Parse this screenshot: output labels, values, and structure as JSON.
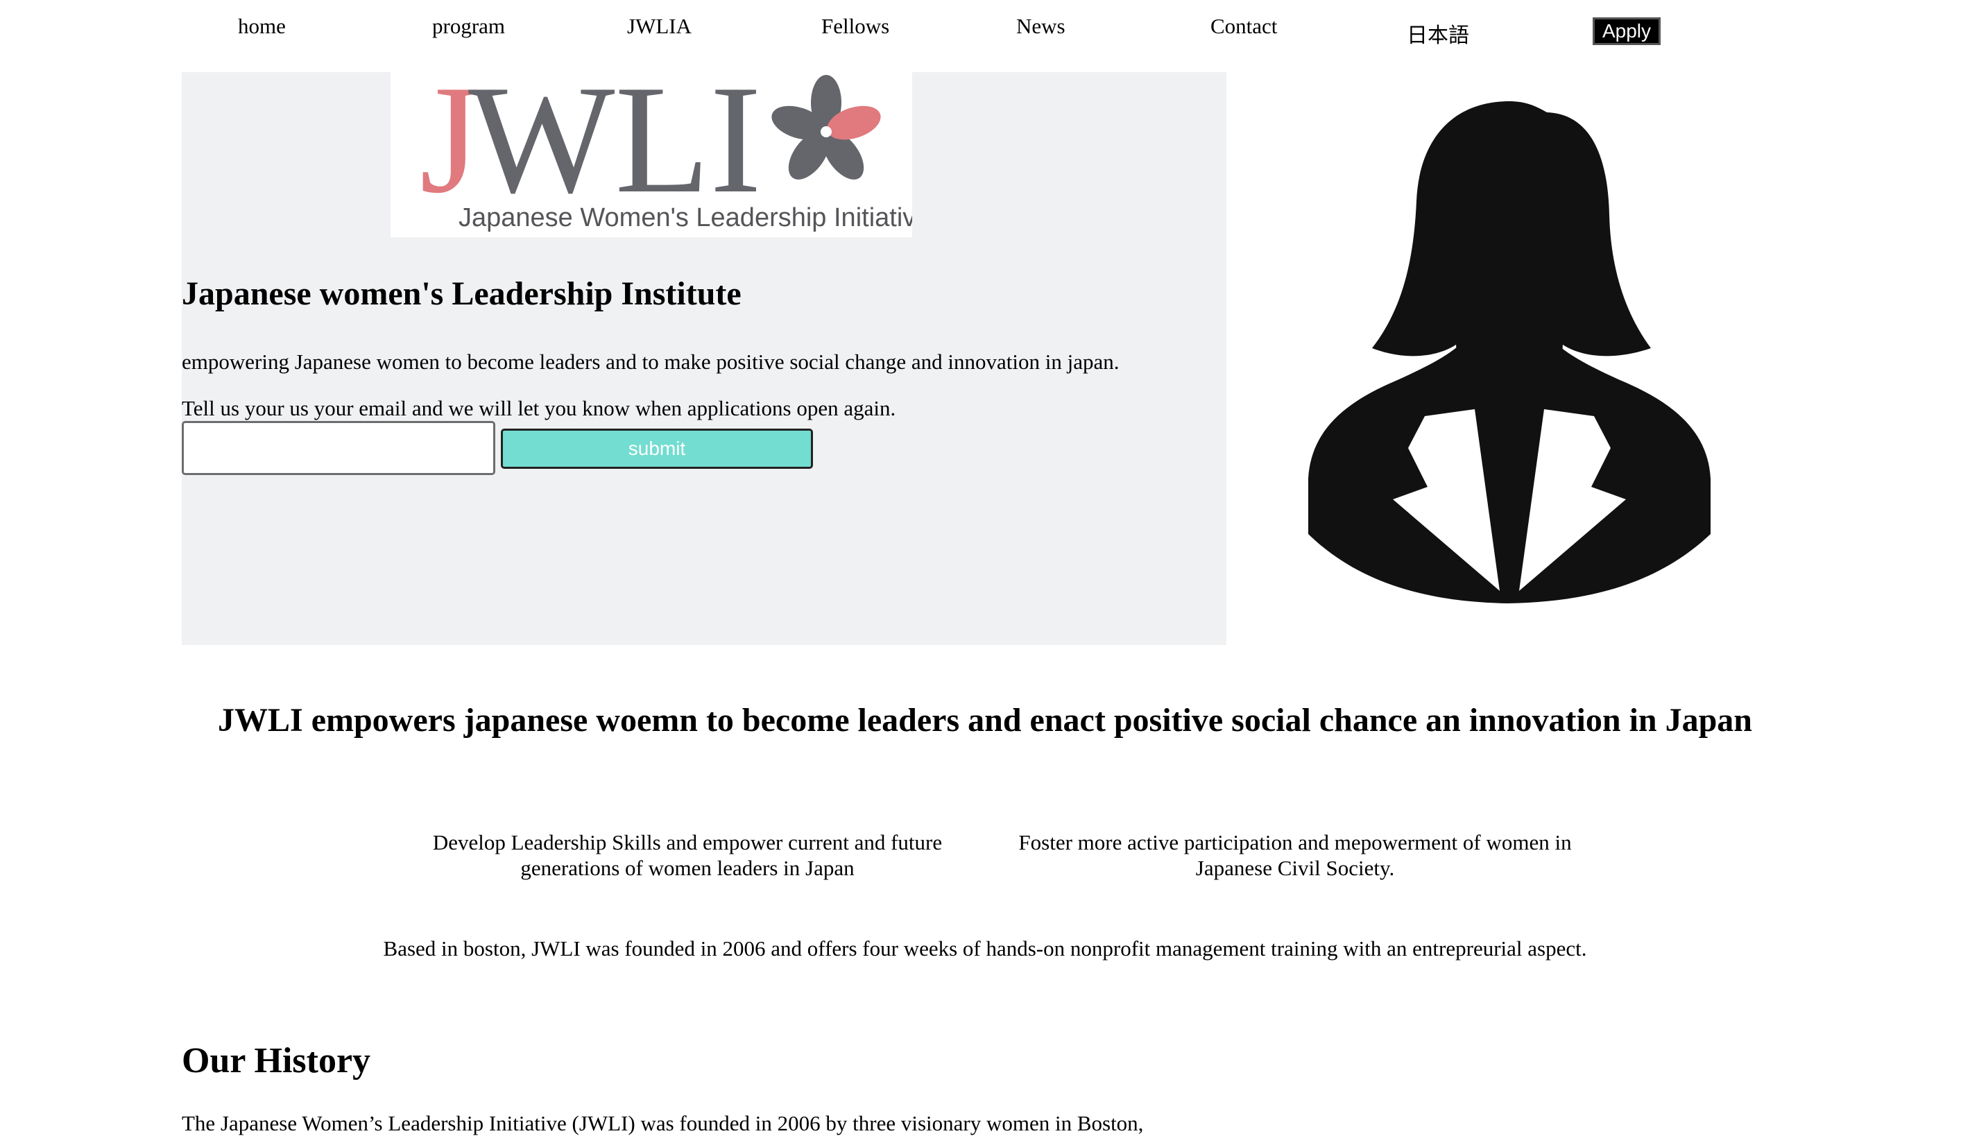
{
  "nav": {
    "items": [
      "home",
      "program",
      "JWLIA",
      "Fellows",
      "News",
      "Contact",
      "日本語"
    ],
    "apply_label": "Apply"
  },
  "hero": {
    "logo": {
      "text": "JWLI",
      "tagline": "Japanese Women's Leadership Initiative",
      "icon": "sakura-flower-icon",
      "accent_color": "#e07a7e",
      "text_color": "#65666b"
    },
    "title": "Japanese women's Leadership Institute",
    "description": "empowering Japanese women to become leaders and to make positive social change and innovation in japan.",
    "email_prompt": "Tell us your us your email and we will let you know when applications open again.",
    "email_value": "",
    "submit_label": "submit",
    "background_color": "#f0f1f3",
    "button_color": "#72ddd0",
    "avatar_icon": "businesswoman-silhouette-icon"
  },
  "mission": {
    "heading": "JWLI empowers japanese woemn to become leaders and enact positive social chance an innovation in Japan",
    "pillars": [
      "Develop Leadership Skills and empower current and future generations of women leaders in Japan",
      "Foster more active participation and mepowerment of women in Japanese Civil Society."
    ],
    "about": "Based in boston, JWLI was founded in 2006 and offers four weeks of hands-on nonprofit management training with an entrepreurial aspect."
  },
  "history": {
    "title": "Our History",
    "text": "The Japanese Women’s Leadership Initiative (JWLI) was founded in 2006 by three visionary women in Boston,"
  }
}
